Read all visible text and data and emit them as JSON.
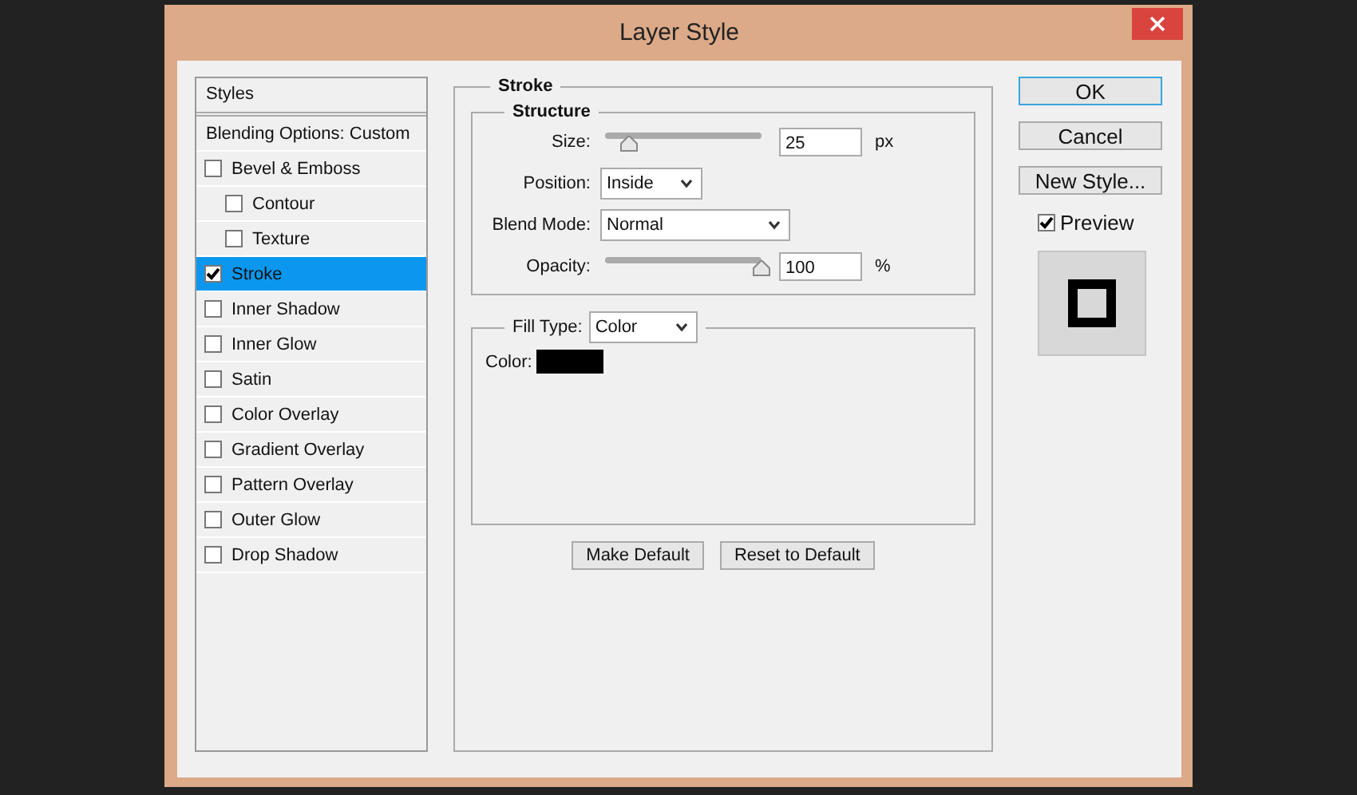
{
  "window": {
    "title": "Layer Style"
  },
  "styles_list": {
    "header": "Styles",
    "blending_options": {
      "label": "Blending Options: Custom",
      "selected": false
    },
    "effects": [
      {
        "label": "Bevel & Emboss",
        "checked": false,
        "selected": false,
        "children": [
          {
            "label": "Contour",
            "checked": false,
            "selected": false
          },
          {
            "label": "Texture",
            "checked": false,
            "selected": false
          }
        ]
      },
      {
        "label": "Stroke",
        "checked": true,
        "selected": true
      },
      {
        "label": "Inner Shadow",
        "checked": false,
        "selected": false
      },
      {
        "label": "Inner Glow",
        "checked": false,
        "selected": false
      },
      {
        "label": "Satin",
        "checked": false,
        "selected": false
      },
      {
        "label": "Color Overlay",
        "checked": false,
        "selected": false
      },
      {
        "label": "Gradient Overlay",
        "checked": false,
        "selected": false
      },
      {
        "label": "Pattern Overlay",
        "checked": false,
        "selected": false
      },
      {
        "label": "Outer Glow",
        "checked": false,
        "selected": false
      },
      {
        "label": "Drop Shadow",
        "checked": false,
        "selected": false
      }
    ]
  },
  "stroke": {
    "title": "Stroke",
    "structure": {
      "title": "Structure",
      "size": {
        "label": "Size:",
        "level": 0.15,
        "value": "25",
        "unit": "px"
      },
      "position": {
        "label": "Position:",
        "value": "Inside"
      },
      "blend_mode": {
        "label": "Blend Mode:",
        "value": "Normal"
      },
      "opacity": {
        "label": "Opacity:",
        "level": 1,
        "value": "100",
        "unit": "%"
      }
    },
    "fill_type": {
      "label": "Fill Type:",
      "value": "Color"
    },
    "color": {
      "label": "Color:",
      "color": "#000000"
    },
    "buttons": [
      "Make Default",
      "Reset to Default"
    ]
  },
  "side_buttons": [
    {
      "label": "OK",
      "default": true
    },
    {
      "label": "Cancel",
      "default": false
    },
    {
      "label": "New Style...",
      "default": false
    }
  ],
  "preview": {
    "label": "Preview",
    "checked": true
  }
}
